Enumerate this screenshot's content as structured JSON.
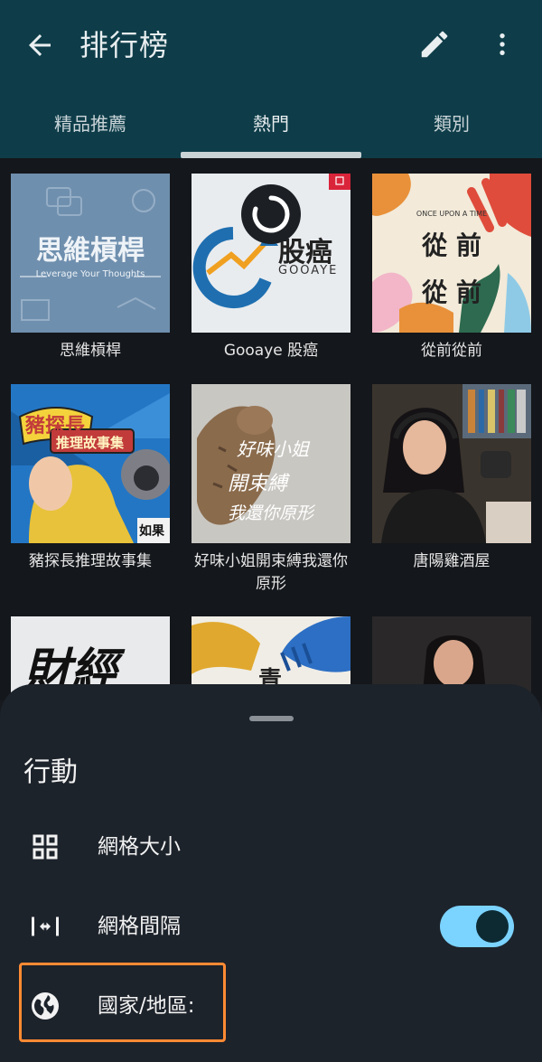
{
  "appbar": {
    "title": "排行榜",
    "back_icon": "arrow-back-icon",
    "edit_icon": "pencil-icon",
    "more_icon": "more-vertical-icon"
  },
  "tabs": [
    {
      "label": "精品推薦",
      "active": false
    },
    {
      "label": "熱門",
      "active": true
    },
    {
      "label": "類別",
      "active": false
    }
  ],
  "podcasts": [
    {
      "title": "思維槓桿",
      "cover_title": "思維槓桿",
      "cover_subtitle": "Leverage Your Thoughts"
    },
    {
      "title": "Gooaye 股癌",
      "cover_title": "股癌",
      "cover_subtitle": "GOOAYE"
    },
    {
      "title": "從前從前",
      "cover_top": "ONCE UPON A TIME",
      "cover_line1": "從 前",
      "cover_line2": "從 前"
    },
    {
      "title": "豬探長推理故事集",
      "cover_title": "豬探長",
      "cover_subtitle": "推理故事集",
      "cover_badge": "如果"
    },
    {
      "title": "好味小姐開束縛我還你原形",
      "cover_line1": "好味小姐",
      "cover_line2": "開束縛",
      "cover_line3": "我還你原形"
    },
    {
      "title": "唐陽雞酒屋"
    },
    {
      "cover_title": "財經"
    },
    {
      "cover_title": "青"
    },
    {}
  ],
  "sheet": {
    "title": "行動",
    "items": [
      {
        "label": "網格大小",
        "icon": "grid-icon"
      },
      {
        "label": "網格間隔",
        "icon": "horizontal-spacing-icon",
        "toggle_on": true
      },
      {
        "label": "國家/地區:",
        "icon": "globe-icon"
      }
    ]
  },
  "colors": {
    "appbar": "#0e3d49",
    "accent": "#7bd3ff",
    "highlight": "#ff8a33",
    "sheet": "#1d232b"
  }
}
